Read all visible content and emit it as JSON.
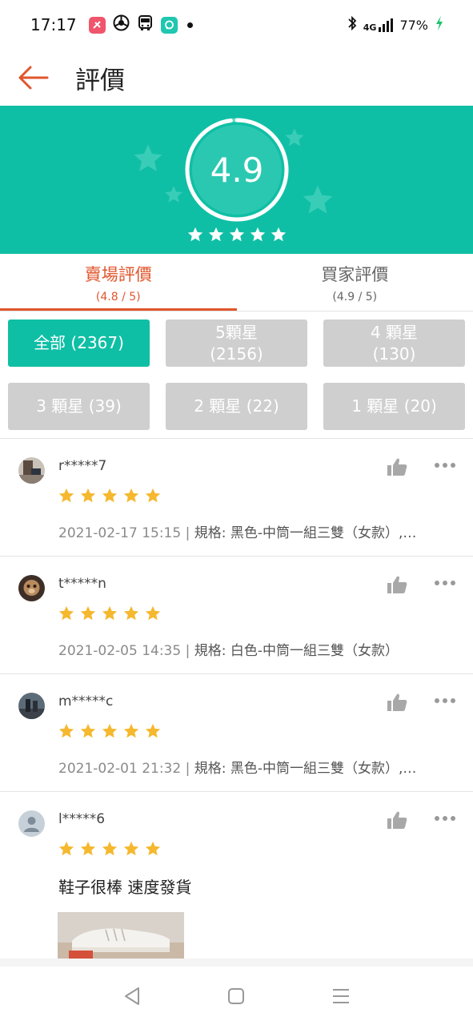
{
  "status_bar": {
    "time": "17:17",
    "network": "4G",
    "battery": "77%",
    "icons": [
      "notification-app-icon",
      "chrome-icon",
      "bus-icon",
      "chat-app-icon",
      "bluetooth-icon",
      "signal-icon",
      "battery-charging-icon"
    ]
  },
  "header": {
    "title": "評價",
    "back_icon": "back-arrow-icon"
  },
  "summary": {
    "score": "4.9",
    "star_count": 5,
    "ring_fill": 0.98
  },
  "tabs": [
    {
      "label": "賣場評價",
      "sub": "(4.8 / 5)",
      "active": true
    },
    {
      "label": "買家評價",
      "sub": "(4.9 / 5)",
      "active": false
    }
  ],
  "filters": [
    {
      "label": "全部 (2367)",
      "active": true
    },
    {
      "label": "5顆星\n(2156)",
      "active": false
    },
    {
      "label": "4 顆星\n(130)",
      "active": false
    },
    {
      "label": "3 顆星 (39)",
      "active": false
    },
    {
      "label": "2 顆星 (22)",
      "active": false
    },
    {
      "label": "1 顆星 (20)",
      "active": false
    }
  ],
  "reviews": [
    {
      "username": "r*****7",
      "stars": 5,
      "date": "2021-02-17 15:15",
      "spec": "規格: 黑色-中筒一組三雙（女款）,…",
      "avatar": "photo"
    },
    {
      "username": "t*****n",
      "stars": 5,
      "date": "2021-02-05 14:35",
      "spec": "規格: 白色-中筒一組三雙（女款）",
      "avatar": "photo"
    },
    {
      "username": "m*****c",
      "stars": 5,
      "date": "2021-02-01 21:32",
      "spec": "規格: 黑色-中筒一組三雙（女款）,…",
      "avatar": "photo"
    },
    {
      "username": "l*****6",
      "stars": 5,
      "text": "鞋子很棒 速度發貨",
      "avatar": "default-user"
    }
  ],
  "colors": {
    "teal": "#0fbfa5",
    "accent": "#e0562d",
    "star": "#f5b82e",
    "filter_inactive": "#cfcfcf"
  }
}
